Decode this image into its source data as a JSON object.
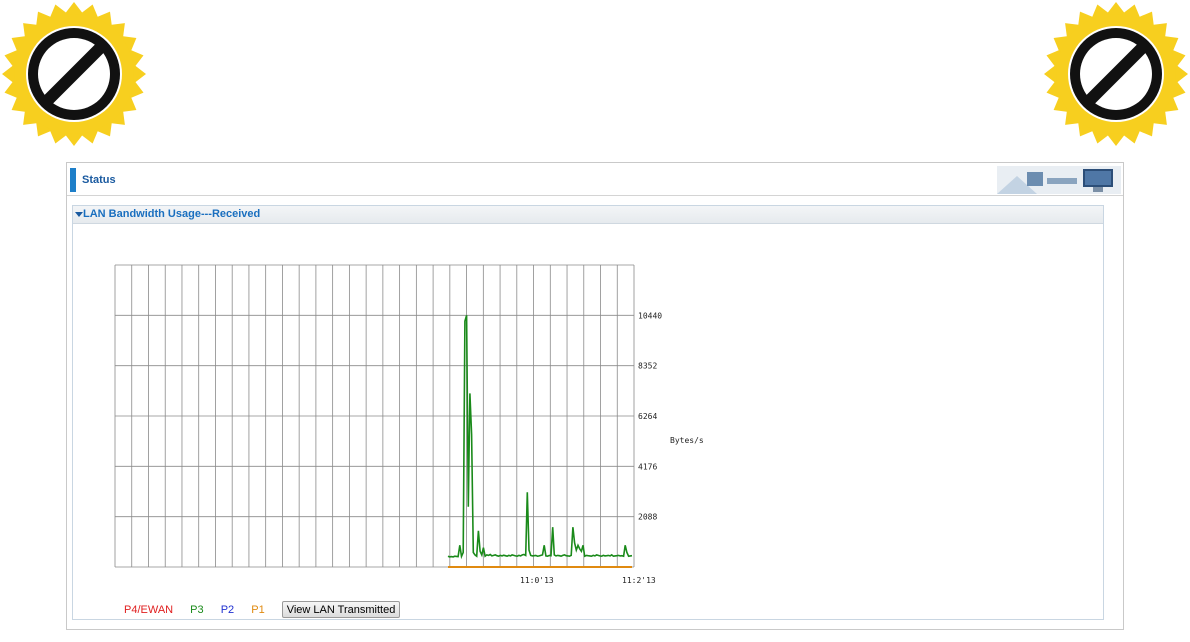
{
  "header": {
    "title": "Status"
  },
  "section": {
    "title": "LAN Bandwidth Usage---Received"
  },
  "legend": [
    {
      "label": "P4/EWAN",
      "color": "#e02020"
    },
    {
      "label": "P3",
      "color": "#1a8a1a"
    },
    {
      "label": "P2",
      "color": "#2030d0"
    },
    {
      "label": "P1",
      "color": "#e08a10"
    }
  ],
  "buttons": {
    "view_transmitted": "View LAN Transmitted"
  },
  "chart_data": {
    "type": "line",
    "title": "",
    "xlabel": "",
    "ylabel": "Bytes/s",
    "grid": true,
    "y_ticks": [
      "2088",
      "4176",
      "6264",
      "8352",
      "10440"
    ],
    "x_ticks": [
      "11:0'13",
      "11:2'13"
    ],
    "y_max": 12528,
    "series": [
      {
        "name": "P3",
        "color": "#1a8a1a",
        "values": [
          450,
          420,
          430,
          420,
          450,
          440,
          430,
          900,
          440,
          600,
          10200,
          10440,
          2500,
          7200,
          5500,
          600,
          500,
          450,
          1500,
          650,
          500,
          800,
          450,
          500,
          480,
          520,
          460,
          480,
          500,
          470,
          450,
          480,
          460,
          490,
          470,
          450,
          480,
          460,
          500,
          480,
          460,
          450,
          480,
          460,
          500,
          520,
          480,
          3100,
          700,
          480,
          460,
          470,
          480,
          450,
          460,
          480,
          500,
          900,
          460,
          450,
          480,
          470,
          1650,
          500,
          460,
          480,
          470,
          450,
          480,
          500,
          470,
          460,
          450,
          480,
          1650,
          1000,
          700,
          900,
          750,
          650,
          900,
          450,
          480,
          470,
          460,
          450,
          480,
          460,
          500,
          480,
          460,
          450,
          480,
          460,
          470,
          480,
          460,
          500,
          450,
          460,
          470,
          480,
          460,
          470,
          450,
          900,
          600,
          450,
          460,
          470
        ]
      },
      {
        "name": "P1",
        "color": "#e08a10",
        "values": [
          0,
          0,
          0,
          0,
          0,
          0,
          0,
          0,
          0,
          0,
          0,
          0,
          0,
          0,
          0,
          0,
          0,
          0,
          0,
          0,
          0,
          0,
          0,
          0,
          0,
          0,
          0,
          0,
          0,
          0,
          0,
          0,
          0,
          0,
          0,
          0,
          0,
          0,
          0,
          0,
          0,
          0,
          0,
          0,
          0,
          0,
          0,
          0,
          0,
          0,
          0,
          0,
          0,
          0,
          0,
          0,
          0,
          0,
          0,
          0,
          0,
          0,
          0,
          0,
          0,
          0,
          0,
          0,
          0,
          0,
          0,
          0,
          0,
          0,
          0,
          0,
          0,
          0,
          0,
          0,
          0,
          0,
          0,
          0,
          0,
          0,
          0,
          0,
          0,
          0,
          0,
          0,
          0,
          0,
          0,
          0,
          0,
          0,
          0,
          0,
          0,
          0,
          0,
          0,
          0,
          0,
          0,
          0,
          0,
          0,
          0,
          0
        ]
      }
    ]
  }
}
